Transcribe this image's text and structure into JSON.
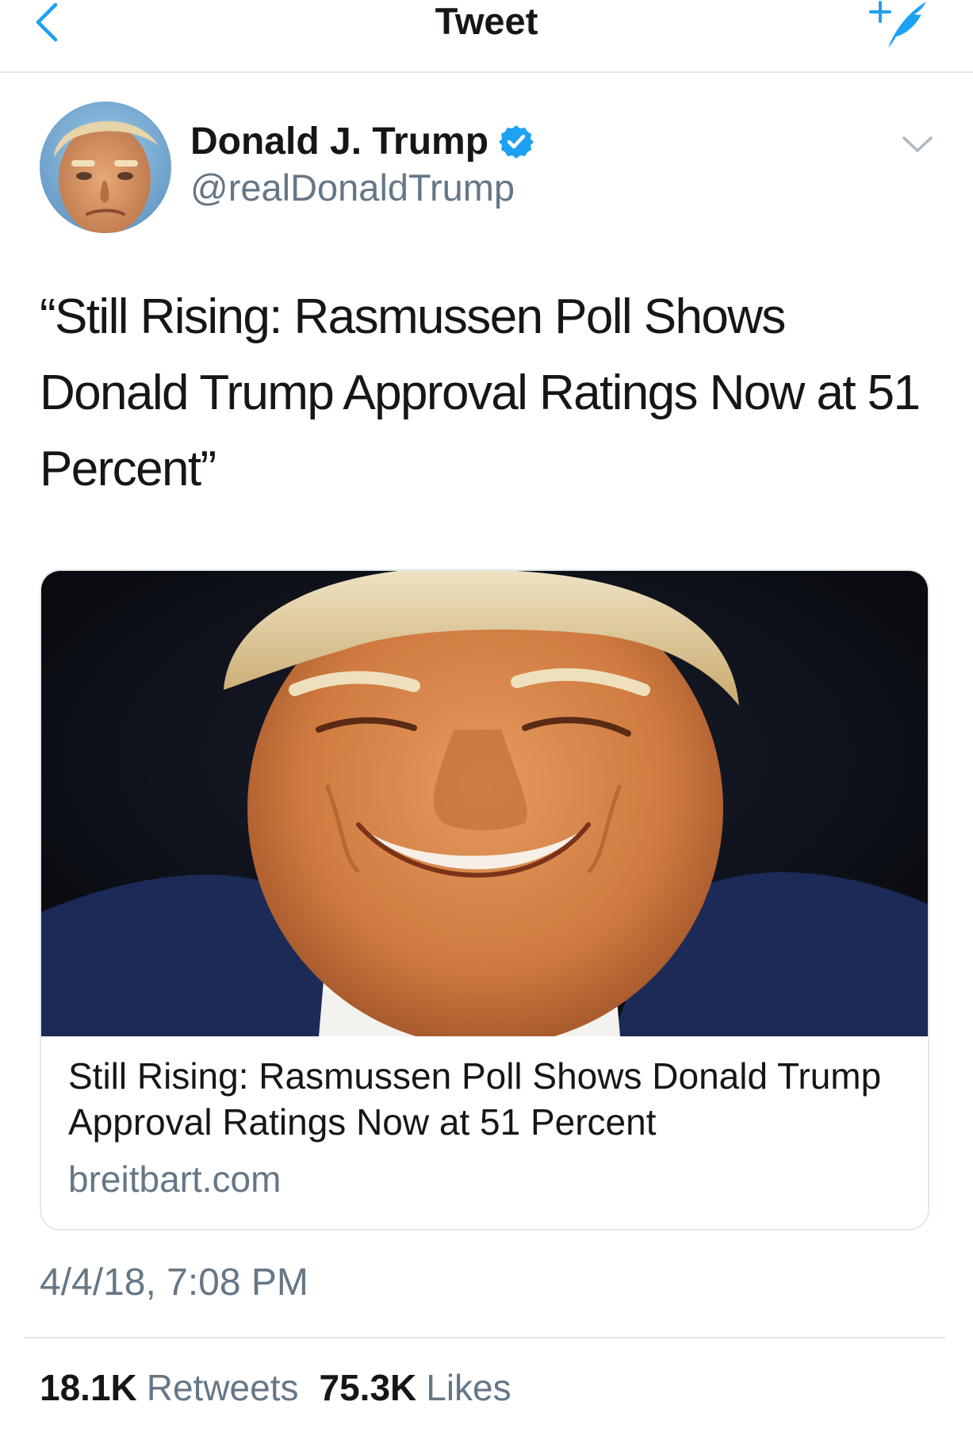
{
  "header": {
    "title": "Tweet",
    "back_icon": "chevron-left-icon",
    "compose_icon": "compose-tweet-icon",
    "accent_color": "#1da1f2"
  },
  "author": {
    "name": "Donald J. Trump",
    "handle": "@realDonaldTrump",
    "verified": true,
    "verified_icon": "verified-badge-icon",
    "menu_icon": "chevron-down-icon"
  },
  "tweet": {
    "text": "“Still Rising: Rasmussen Poll Shows Donald Trump Approval Ratings Now at 51 Percent”",
    "timestamp": "4/4/18, 7:08 PM"
  },
  "card": {
    "title": "Still Rising: Rasmussen Poll Shows Donald Trump Approval Ratings Now at 51 Percent",
    "domain": "breitbart.com"
  },
  "stats": {
    "retweets_count": "18.1K",
    "retweets_label": "Retweets",
    "likes_count": "75.3K",
    "likes_label": "Likes"
  },
  "colors": {
    "text_primary": "#14171a",
    "text_secondary": "#657786",
    "border": "#e1e8ed",
    "verified": "#1da1f2"
  }
}
